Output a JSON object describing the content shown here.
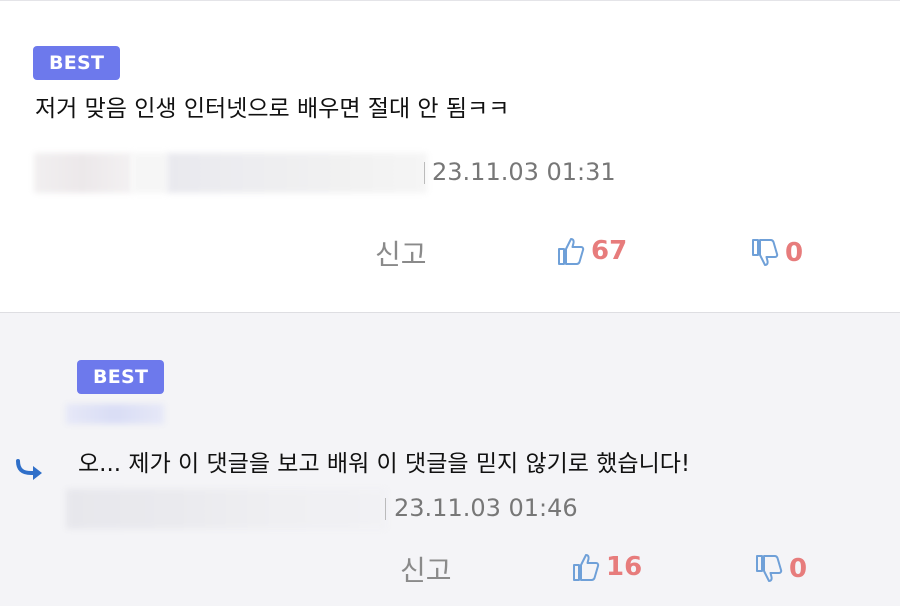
{
  "comments": [
    {
      "badge": "BEST",
      "text": "저거 맞음 인생 인터넷으로 배우면 절대 안 됨ㅋㅋ",
      "timestamp": "23.11.03 01:31",
      "report_label": "신고",
      "likes": "67",
      "dislikes": "0"
    },
    {
      "badge": "BEST",
      "text": "오... 제가 이 댓글을 보고 배워 이 댓글을 믿지 않기로 했습니다!",
      "timestamp": "23.11.03 01:46",
      "report_label": "신고",
      "likes": "16",
      "dislikes": "0",
      "is_reply": true
    }
  ],
  "icons": {
    "like": "thumbs-up-icon",
    "dislike": "thumbs-down-icon",
    "reply": "reply-arrow-icon"
  },
  "colors": {
    "badge": "#6d79ec",
    "count": "#e77c7c",
    "icon": "#6fa0d8",
    "reply_arrow": "#2f6fc9",
    "reply_bg": "#f4f4f7"
  }
}
